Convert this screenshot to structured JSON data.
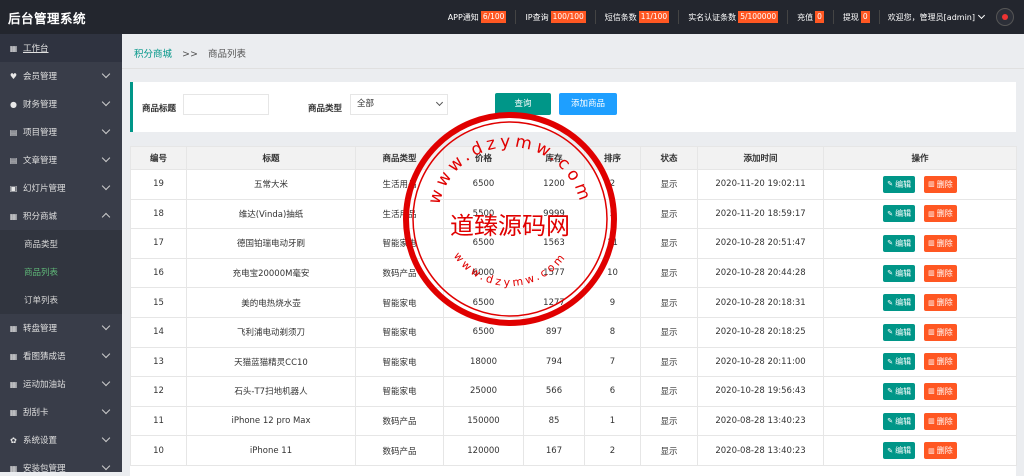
{
  "app": {
    "title": "后台管理系统"
  },
  "topbar": {
    "stats": [
      {
        "label": "APP通知",
        "badge": "6/100"
      },
      {
        "label": "IP查询",
        "badge": "100/100"
      },
      {
        "label": "短信条数",
        "badge": "11/100"
      },
      {
        "label": "实名认证条数",
        "badge": "5/100000"
      },
      {
        "label": "充值",
        "badge": "0"
      },
      {
        "label": "提现",
        "badge": "0"
      }
    ],
    "welcome": "欢迎您，管理员[admin]"
  },
  "sidebar": {
    "items": [
      {
        "label": "工作台",
        "icon": "dashboard-icon"
      },
      {
        "label": "会员管理",
        "icon": "heart-icon"
      },
      {
        "label": "财务管理",
        "icon": "finance-icon"
      },
      {
        "label": "项目管理",
        "icon": "project-icon"
      },
      {
        "label": "文章管理",
        "icon": "article-icon"
      },
      {
        "label": "幻灯片管理",
        "icon": "slides-icon"
      },
      {
        "label": "积分商城",
        "icon": "grid-icon"
      }
    ],
    "sub_items": [
      {
        "label": "商品类型"
      },
      {
        "label": "商品列表"
      },
      {
        "label": "订单列表"
      }
    ],
    "items_after": [
      {
        "label": "转盘管理",
        "icon": "grid-icon"
      },
      {
        "label": "看图猜成语",
        "icon": "grid-icon"
      },
      {
        "label": "运动加油站",
        "icon": "grid-icon"
      },
      {
        "label": "刮刮卡",
        "icon": "grid-icon"
      },
      {
        "label": "系统设置",
        "icon": "gear-icon"
      },
      {
        "label": "安装包管理",
        "icon": "grid-icon"
      }
    ]
  },
  "breadcrumb": {
    "parent": "积分商城",
    "separator": ">>",
    "current": "商品列表"
  },
  "filter": {
    "title_label": "商品标题",
    "title_value": "",
    "type_label": "商品类型",
    "type_value": "全部",
    "search_label": "查询",
    "add_label": "添加商品"
  },
  "table": {
    "headers": [
      "编号",
      "标题",
      "商品类型",
      "价格",
      "库存",
      "排序",
      "状态",
      "添加时间",
      "操作"
    ],
    "edit_label": "编辑",
    "delete_label": "删除",
    "rows": [
      [
        "19",
        "五常大米",
        "生活用品",
        "6500",
        "1200",
        "2",
        "显示",
        "2020-11-20 19:02:11"
      ],
      [
        "18",
        "维达(Vinda)抽纸",
        "生活用品",
        "5500",
        "9999",
        "5",
        "显示",
        "2020-11-20 18:59:17"
      ],
      [
        "17",
        "德国铂瑞电动牙刷",
        "智能家电",
        "6500",
        "1563",
        "11",
        "显示",
        "2020-10-28 20:51:47"
      ],
      [
        "16",
        "充电宝20000M毫安",
        "数码产品",
        "6000",
        "1577",
        "10",
        "显示",
        "2020-10-28 20:44:28"
      ],
      [
        "15",
        "美的电热烧水壶",
        "智能家电",
        "6500",
        "1277",
        "9",
        "显示",
        "2020-10-28 20:18:31"
      ],
      [
        "14",
        "飞利浦电动剃须刀",
        "智能家电",
        "6500",
        "897",
        "8",
        "显示",
        "2020-10-28 20:18:25"
      ],
      [
        "13",
        "天猫蓝猫精灵CC10",
        "智能家电",
        "18000",
        "794",
        "7",
        "显示",
        "2020-10-28 20:11:00"
      ],
      [
        "12",
        "石头-T7扫地机器人",
        "智能家电",
        "25000",
        "566",
        "6",
        "显示",
        "2020-10-28 19:56:43"
      ],
      [
        "11",
        "iPhone 12 pro Max",
        "数码产品",
        "150000",
        "85",
        "1",
        "显示",
        "2020-08-28 13:40:23"
      ],
      [
        "10",
        "iPhone 11",
        "数码产品",
        "120000",
        "167",
        "2",
        "显示",
        "2020-08-28 13:40:23"
      ]
    ]
  },
  "watermark": {
    "text": "道臻源码网",
    "url_top": "www.dzymw.com",
    "url_bottom": "www.dzymw.com",
    "color": "#e00000"
  }
}
